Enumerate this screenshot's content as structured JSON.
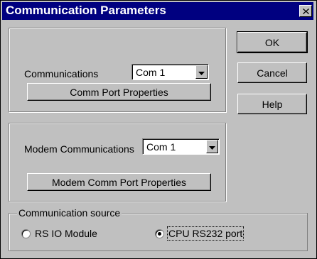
{
  "dialog": {
    "title": "Communication Parameters",
    "close_label": "×"
  },
  "communications": {
    "label": "Communications",
    "selected": "Com 1",
    "properties_button": "Comm Port Properties"
  },
  "modem": {
    "label": "Modem Communications",
    "selected": "Com 1",
    "properties_button": "Modem Comm Port Properties"
  },
  "source": {
    "legend": "Communication source",
    "options": [
      {
        "label": "RS IO Module",
        "checked": false
      },
      {
        "label": "CPU RS232 port",
        "checked": true
      }
    ]
  },
  "buttons": {
    "ok": "OK",
    "cancel": "Cancel",
    "help": "Help"
  },
  "colors": {
    "titlebar": "#000080",
    "face": "#c0c0c0"
  },
  "icons": {
    "close": "close-icon",
    "dropdown": "chevron-down-icon"
  }
}
